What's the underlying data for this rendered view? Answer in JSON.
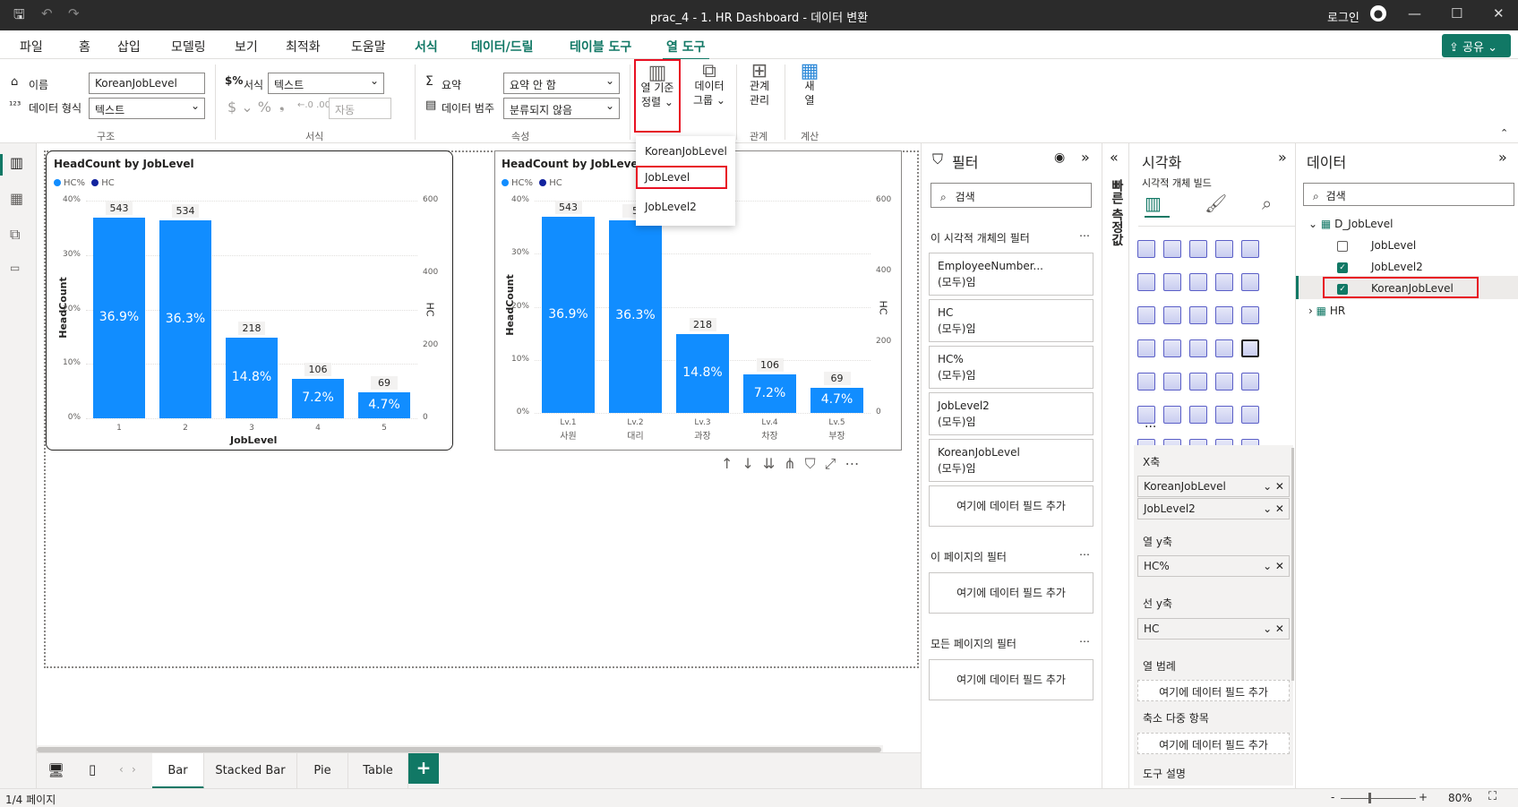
{
  "window": {
    "title": "prac_4 - 1. HR Dashboard - 데이터 변환",
    "login": "로그인"
  },
  "menu": {
    "items": [
      "파일",
      "홈",
      "삽입",
      "모델링",
      "보기",
      "최적화",
      "도움말",
      "서식",
      "데이터/드릴",
      "테이블 도구",
      "열 도구"
    ],
    "share": "공유"
  },
  "ribbon": {
    "name_label": "이름",
    "name_value": "KoreanJobLevel",
    "dtype_label": "데이터 형식",
    "dtype_value": "텍스트",
    "format_label": "서식",
    "format_value": "텍스트",
    "auto_value": "자동",
    "group_structure": "구조",
    "group_format": "서식",
    "group_props": "속성",
    "group_rel": "관계",
    "group_calc": "계산",
    "summary_label": "요약",
    "summary_value": "요약 안 함",
    "category_label": "데이터 범주",
    "category_value": "분류되지 않음",
    "sort_btn_1": "열 기준",
    "sort_btn_2": "정렬",
    "group_btn_1": "데이터",
    "group_btn_2": "그룹",
    "rel_btn_1": "관계",
    "rel_btn_2": "관리",
    "new_btn_1": "새",
    "new_btn_2": "열"
  },
  "sort_menu": {
    "items": [
      "KoreanJobLevel",
      "JobLevel",
      "JobLevel2"
    ]
  },
  "chart_data": [
    {
      "type": "bar",
      "title": "HeadCount by JobLevel",
      "legend": [
        "HC%",
        "HC"
      ],
      "xlabel": "JobLevel",
      "ylabel": "HeadCount",
      "y2label": "HC",
      "categories": [
        "1",
        "2",
        "3",
        "4",
        "5"
      ],
      "series": [
        {
          "name": "HC%",
          "values": [
            36.9,
            36.3,
            14.8,
            7.2,
            4.7
          ],
          "labels": [
            "36.9%",
            "36.3%",
            "14.8%",
            "7.2%",
            "4.7%"
          ]
        },
        {
          "name": "HC",
          "values": [
            543,
            534,
            218,
            106,
            69
          ]
        }
      ],
      "yticks": [
        "40%",
        "30%",
        "20%",
        "10%",
        "0%"
      ],
      "y2ticks": [
        "600",
        "400",
        "200",
        "0"
      ],
      "ylim": [
        0,
        40
      ],
      "y2lim": [
        0,
        600
      ]
    },
    {
      "type": "bar",
      "title": "HeadCount by JobLevel",
      "legend": [
        "HC%",
        "HC"
      ],
      "xlabel": "",
      "ylabel": "HeadCount",
      "y2label": "HC",
      "categories": [
        "Lv.1",
        "Lv.2",
        "Lv.3",
        "Lv.4",
        "Lv.5"
      ],
      "subcategories": [
        "사원",
        "대리",
        "과장",
        "차장",
        "부장"
      ],
      "series": [
        {
          "name": "HC%",
          "values": [
            36.9,
            36.3,
            14.8,
            7.2,
            4.7
          ],
          "labels": [
            "36.9%",
            "36.3%",
            "14.8%",
            "7.2%",
            "4.7%"
          ]
        },
        {
          "name": "HC",
          "values": [
            543,
            534,
            218,
            106,
            69
          ],
          "labels": [
            "543",
            "5",
            "218",
            "106",
            "69"
          ]
        }
      ],
      "yticks": [
        "40%",
        "30%",
        "20%",
        "10%",
        "0%"
      ],
      "y2ticks": [
        "600",
        "400",
        "200",
        "0"
      ],
      "ylim": [
        0,
        40
      ],
      "y2lim": [
        0,
        600
      ]
    }
  ],
  "filters": {
    "title": "필터",
    "search": "검색",
    "visual_section": "이 시각적 개체의 필터",
    "cards": [
      {
        "name": "EmployeeNumber...",
        "state": "(모두)임"
      },
      {
        "name": "HC",
        "state": "(모두)임"
      },
      {
        "name": "HC%",
        "state": "(모두)임"
      },
      {
        "name": "JobLevel2",
        "state": "(모두)임"
      },
      {
        "name": "KoreanJobLevel",
        "state": "(모두)임"
      }
    ],
    "add": "여기에 데이터 필드 추가",
    "page_section": "이 페이지의 필터",
    "all_section": "모든 페이지의 필터"
  },
  "quick_measure": "빠른 측정값",
  "viz": {
    "title": "시각화",
    "build": "시각적 개체 빌드",
    "more": "...",
    "x_axis": "X축",
    "x_fields": [
      "KoreanJobLevel",
      "JobLevel2"
    ],
    "col_y": "열 y축",
    "col_y_field": "HC%",
    "line_y": "선 y축",
    "line_y_field": "HC",
    "legend": "열 범례",
    "legend_add": "여기에 데이터 필드 추가",
    "small_mult": "축소 다중 항목",
    "small_add": "여기에 데이터 필드 추가",
    "tooltip": "도구 설명"
  },
  "data_pane": {
    "title": "데이터",
    "search": "검색",
    "tables": [
      {
        "name": "D_JobLevel",
        "fields": [
          {
            "name": "JobLevel",
            "checked": false
          },
          {
            "name": "JobLevel2",
            "checked": true
          },
          {
            "name": "KoreanJobLevel",
            "checked": true
          }
        ]
      },
      {
        "name": "HR",
        "fields": []
      }
    ]
  },
  "pages": [
    "Bar",
    "Stacked Bar",
    "Pie",
    "Table"
  ],
  "status": {
    "page": "1/4 페이지",
    "zoom": "80%"
  }
}
